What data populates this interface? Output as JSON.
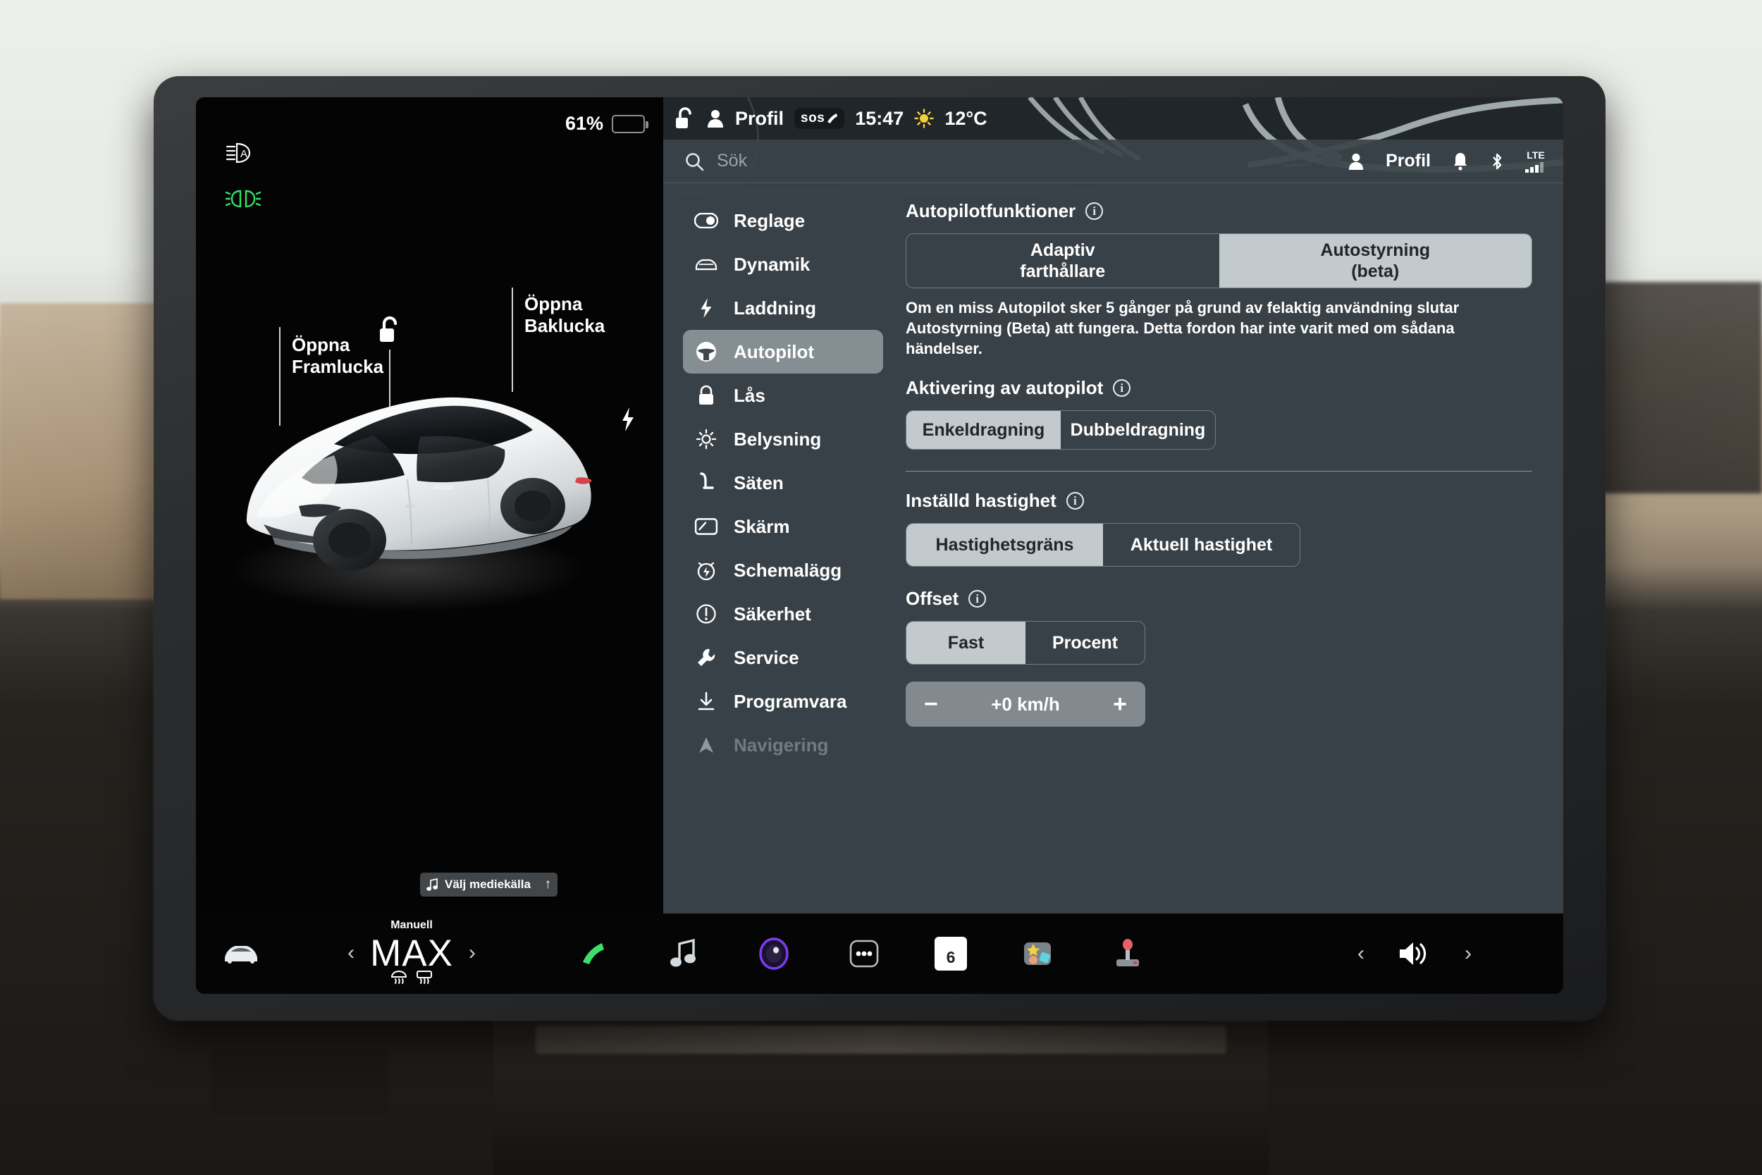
{
  "drive_view": {
    "battery_percent": "61%",
    "battery_level": 61,
    "indicators": [
      {
        "name": "auto-headlight-icon",
        "color": "#ffffff"
      },
      {
        "name": "parking-lights-icon",
        "color": "#35e06b"
      }
    ],
    "labels": {
      "front_trunk": "Öppna\nFramlucka",
      "front_trunk_line1": "Öppna",
      "front_trunk_line2": "Framlucka",
      "rear_trunk_line1": "Öppna",
      "rear_trunk_line2": "Baklucka"
    },
    "media_button": {
      "label": "Välj mediekälla",
      "icon": "music-note-icon",
      "arrow": "↑"
    }
  },
  "status_bar": {
    "lock_icon": "unlock-icon",
    "profile_icon": "person-icon",
    "profile_label": "Profil",
    "sos_label": "sos",
    "time": "15:47",
    "weather_icon": "sun-icon",
    "temperature": "12°C"
  },
  "search": {
    "icon": "search-icon",
    "placeholder": "Sök",
    "profile_label": "Profil",
    "icons": [
      "bell-icon",
      "bluetooth-icon",
      "lte-signal-icon"
    ],
    "network_label": "LTE"
  },
  "sidebar": {
    "items": [
      {
        "label": "Reglage",
        "icon": "toggle-icon",
        "active": false
      },
      {
        "label": "Dynamik",
        "icon": "car-icon",
        "active": false
      },
      {
        "label": "Laddning",
        "icon": "bolt-icon",
        "active": false
      },
      {
        "label": "Autopilot",
        "icon": "steering-icon",
        "active": true
      },
      {
        "label": "Lås",
        "icon": "lock-icon",
        "active": false
      },
      {
        "label": "Belysning",
        "icon": "brightness-icon",
        "active": false
      },
      {
        "label": "Säten",
        "icon": "seat-icon",
        "active": false
      },
      {
        "label": "Skärm",
        "icon": "display-icon",
        "active": false
      },
      {
        "label": "Schemalägg",
        "icon": "alarm-icon",
        "active": false
      },
      {
        "label": "Säkerhet",
        "icon": "warning-icon",
        "active": false
      },
      {
        "label": "Service",
        "icon": "wrench-icon",
        "active": false
      },
      {
        "label": "Programvara",
        "icon": "download-icon",
        "active": false
      },
      {
        "label": "Navigering",
        "icon": "navigation-icon",
        "active": false
      }
    ]
  },
  "settings": {
    "autopilot_features": {
      "title": "Autopilotfunktioner",
      "options": [
        {
          "label": "Adaptiv farthållare",
          "line1": "Adaptiv",
          "line2": "farthållare",
          "selected": false
        },
        {
          "label": "Autostyrning (beta)",
          "line1": "Autostyrning",
          "line2": "(beta)",
          "selected": true
        }
      ],
      "note": "Om en miss Autopilot sker 5 gånger på grund av felaktig användning slutar Autostyrning (Beta) att fungera. Detta fordon har inte varit med om sådana händelser."
    },
    "activation": {
      "title": "Aktivering av autopilot",
      "options": [
        {
          "label": "Enkeldragning",
          "selected": true
        },
        {
          "label": "Dubbeldragning",
          "selected": false
        }
      ]
    },
    "set_speed": {
      "title": "Inställd hastighet",
      "options": [
        {
          "label": "Hastighetsgräns",
          "selected": true
        },
        {
          "label": "Aktuell hastighet",
          "selected": false
        }
      ]
    },
    "offset": {
      "title": "Offset",
      "options": [
        {
          "label": "Fast",
          "selected": true
        },
        {
          "label": "Procent",
          "selected": false
        }
      ],
      "stepper": {
        "minus": "−",
        "value": "+0 km/h",
        "plus": "+"
      }
    }
  },
  "dock": {
    "car_icon": "car-icon",
    "climate": {
      "mode_label": "Manuell",
      "temperature": "MAX",
      "prev": "‹",
      "next": "›",
      "defrost_icons": [
        "front-defrost-icon",
        "rear-defrost-icon"
      ]
    },
    "apps": [
      {
        "name": "phone-app-icon"
      },
      {
        "name": "media-app-icon"
      },
      {
        "name": "camera-app-icon"
      },
      {
        "name": "more-apps-icon"
      },
      {
        "name": "calendar-app-icon",
        "day": "6"
      },
      {
        "name": "toybox-app-icon"
      },
      {
        "name": "joystick-app-icon"
      }
    ],
    "volume": {
      "prev": "‹",
      "icon": "volume-icon",
      "next": "›"
    }
  }
}
